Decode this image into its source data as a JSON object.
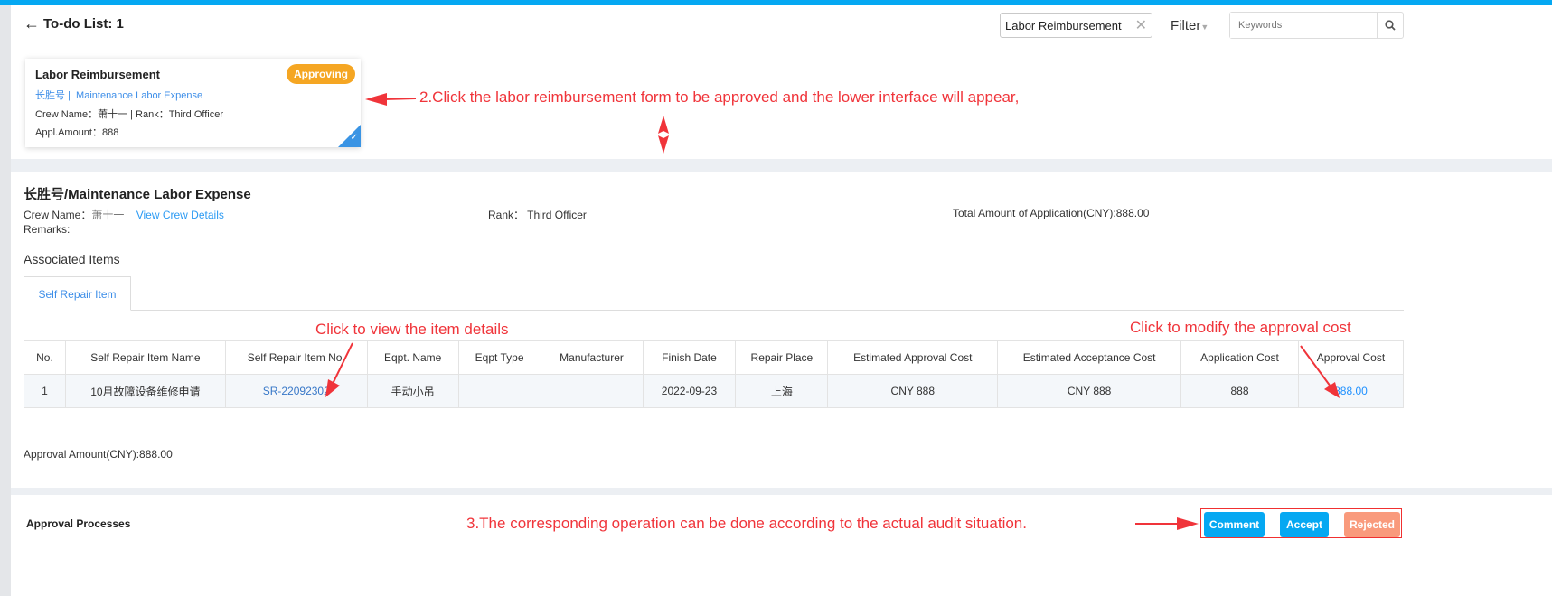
{
  "header": {
    "title": "To-do List: 1",
    "filter_chip": "Labor Reimbursement",
    "filter_label": "Filter",
    "search_placeholder": "Keywords"
  },
  "card": {
    "title": "Labor Reimbursement",
    "status": "Approving",
    "vessel": "长胜号 |",
    "category": "Maintenance Labor Expense",
    "crew_line": "Crew Name：萧十一 | Rank：Third Officer",
    "amount_line": "Appl.Amount：888"
  },
  "annotations": {
    "step2": "2.Click the labor reimbursement form to be approved and the lower interface will appear,",
    "item_details": "Click to view the item details",
    "modify_cost": "Click to modify the approval cost",
    "step3": "3.The corresponding operation can be done according to the actual audit situation."
  },
  "detail": {
    "title": "长胜号/Maintenance Labor Expense",
    "crew_label": "Crew Name：",
    "crew_value": "萧十一",
    "view_crew": "View Crew Details",
    "rank": "Rank：  Third Officer",
    "total": "Total Amount of Application(CNY):888.00",
    "remarks": "Remarks:",
    "associated": "Associated Items",
    "tab": "Self Repair Item",
    "approval_amount": "Approval Amount(CNY):888.00"
  },
  "table": {
    "headers": [
      "No.",
      "Self Repair Item Name",
      "Self Repair Item No.",
      "Eqpt. Name",
      "Eqpt Type",
      "Manufacturer",
      "Finish Date",
      "Repair Place",
      "Estimated Approval Cost",
      "Estimated Acceptance Cost",
      "Application Cost",
      "Approval Cost"
    ],
    "rows": [
      [
        "1",
        "10月故障设备维修申请",
        "SR-22092302",
        "手动小吊",
        "",
        "",
        "2022-09-23",
        "上海",
        "CNY 888",
        "CNY 888",
        "888",
        "888.00"
      ]
    ]
  },
  "approval": {
    "title": "Approval Processes",
    "comment": "Comment",
    "accept": "Accept",
    "rejected": "Rejected"
  },
  "colors": {
    "primary": "#05a8f2",
    "approving": "#f5a623",
    "rejected": "#f99a7c",
    "annotation": "#f0343a"
  }
}
